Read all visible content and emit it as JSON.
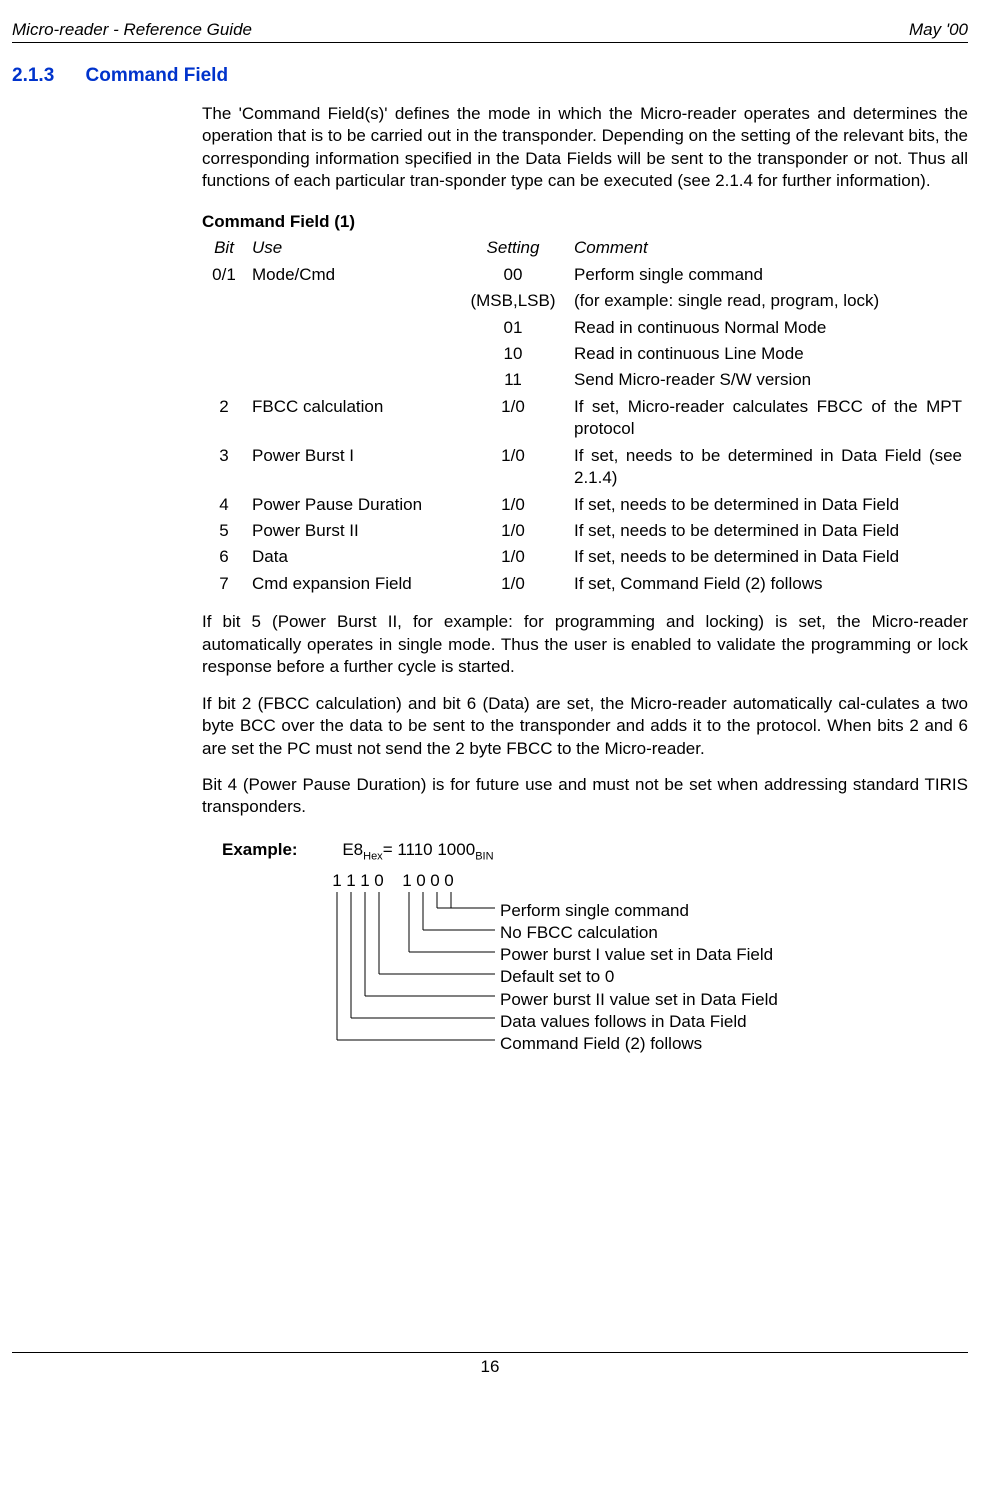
{
  "header": {
    "left": "Micro-reader - Reference Guide",
    "right": "May '00"
  },
  "section": {
    "num": "2.1.3",
    "title": "Command Field"
  },
  "para1": "The 'Command Field(s)' defines the mode in which the Micro-reader operates and determines the operation that is to be carried out in the transponder. Depending on the setting of the relevant bits, the corresponding information specified in the Data Fields will be sent to the transponder or not. Thus all functions of each particular tran-sponder type can be executed (see 2.1.4 for further information).",
  "table": {
    "title": "Command Field (1)",
    "headers": {
      "bit": "Bit",
      "use": "Use",
      "setting": "Setting",
      "comment": "Comment"
    },
    "rows": [
      {
        "bit": "0/1",
        "use": "Mode/Cmd",
        "setting": "00",
        "comment": "Perform single command"
      },
      {
        "bit": "",
        "use": "",
        "setting": "(MSB,LSB)",
        "comment": "(for example: single read, program, lock)"
      },
      {
        "bit": "",
        "use": "",
        "setting": "01",
        "comment": "Read in continuous Normal Mode"
      },
      {
        "bit": "",
        "use": "",
        "setting": "10",
        "comment": "Read in continuous Line Mode"
      },
      {
        "bit": "",
        "use": "",
        "setting": "11",
        "comment": "Send Micro-reader S/W version"
      },
      {
        "bit": "2",
        "use": "FBCC calculation",
        "setting": "1/0",
        "comment": "If set, Micro-reader calculates FBCC of the MPT protocol"
      },
      {
        "bit": "3",
        "use": "Power Burst I",
        "setting": "1/0",
        "comment": "If set, needs to be determined in Data Field (see 2.1.4)"
      },
      {
        "bit": "4",
        "use": "Power Pause Duration",
        "setting": "1/0",
        "comment": "If set, needs to be determined in Data Field"
      },
      {
        "bit": "5",
        "use": "Power Burst II",
        "setting": "1/0",
        "comment": "If set, needs to be determined in Data Field"
      },
      {
        "bit": "6",
        "use": "Data",
        "setting": "1/0",
        "comment": "If set, needs to be determined in Data Field"
      },
      {
        "bit": "7",
        "use": "Cmd expansion Field",
        "setting": "1/0",
        "comment": "If set, Command Field (2) follows"
      }
    ]
  },
  "para2": "If bit 5 (Power Burst II, for example: for programming and locking) is set, the Micro-reader automatically operates in single mode. Thus the user is enabled to validate the programming or lock response before a further cycle is started.",
  "para3": "If bit 2 (FBCC calculation) and bit 6 (Data) are set, the Micro-reader automatically cal-culates a two byte BCC over the data to be sent to the transponder and adds it to the protocol. When bits 2 and 6 are set the PC must not send the 2 byte FBCC to the Micro-reader.",
  "para4": "Bit 4 (Power Pause Duration) is for future use and must not be set when addressing standard TIRIS transponders.",
  "example": {
    "label": "Example:",
    "hex_prefix": "E8",
    "hex_sub": "Hex",
    "mid": "= 1110 1000",
    "bin_sub": "BIN",
    "bits": [
      "1",
      "1",
      "1",
      "0",
      "1",
      "0",
      "0",
      "0"
    ],
    "annotations": [
      "Perform single command",
      "No FBCC calculation",
      "Power burst I value set in Data Field",
      "Default set to 0",
      "Power burst II value set in Data Field",
      "Data values follows in Data Field",
      "Command Field (2) follows"
    ]
  },
  "page_number": "16"
}
